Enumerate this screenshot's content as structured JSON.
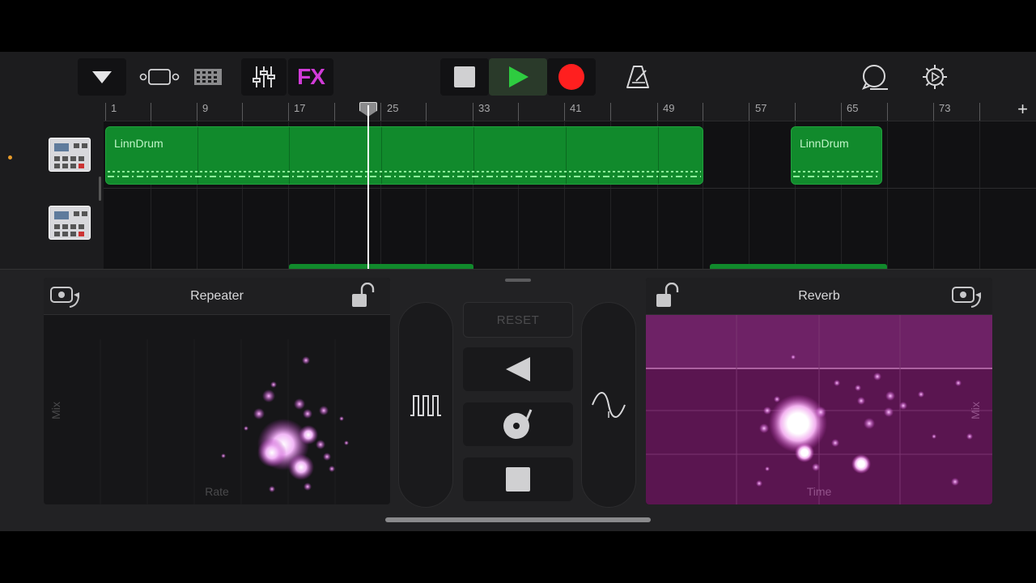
{
  "toolbar": {
    "fx_label": "FX",
    "colors": {
      "play": "#2ecc40",
      "record": "#ff1f1f",
      "fx": "#d13bd8"
    },
    "icons": [
      "chevron-down-icon",
      "tracks-view-icon",
      "drum-grid-icon",
      "mixer-icon",
      "stop-icon",
      "play-icon",
      "record-icon",
      "metronome-icon",
      "loop-icon",
      "settings-icon"
    ]
  },
  "ruler": {
    "ticks": [
      "1",
      "9",
      "17",
      "25",
      "33",
      "41",
      "49",
      "57",
      "65",
      "73"
    ],
    "add_label": "+"
  },
  "tracks": [
    {
      "instrument_icon": "drum-machine-icon",
      "regions": [
        {
          "name": ""
        },
        {
          "name": "LinnDrum"
        }
      ]
    },
    {
      "instrument_icon": "drum-machine-icon"
    }
  ],
  "regions": {
    "first_name": "LinnDrum",
    "second_name": "LinnDrum"
  },
  "fx": {
    "left": {
      "title": "Repeater",
      "x_axis": "Rate",
      "y_axis": "Mix"
    },
    "right": {
      "title": "Reverb",
      "x_axis": "Time",
      "y_axis": "Mix"
    },
    "reset_label": "RESET"
  }
}
